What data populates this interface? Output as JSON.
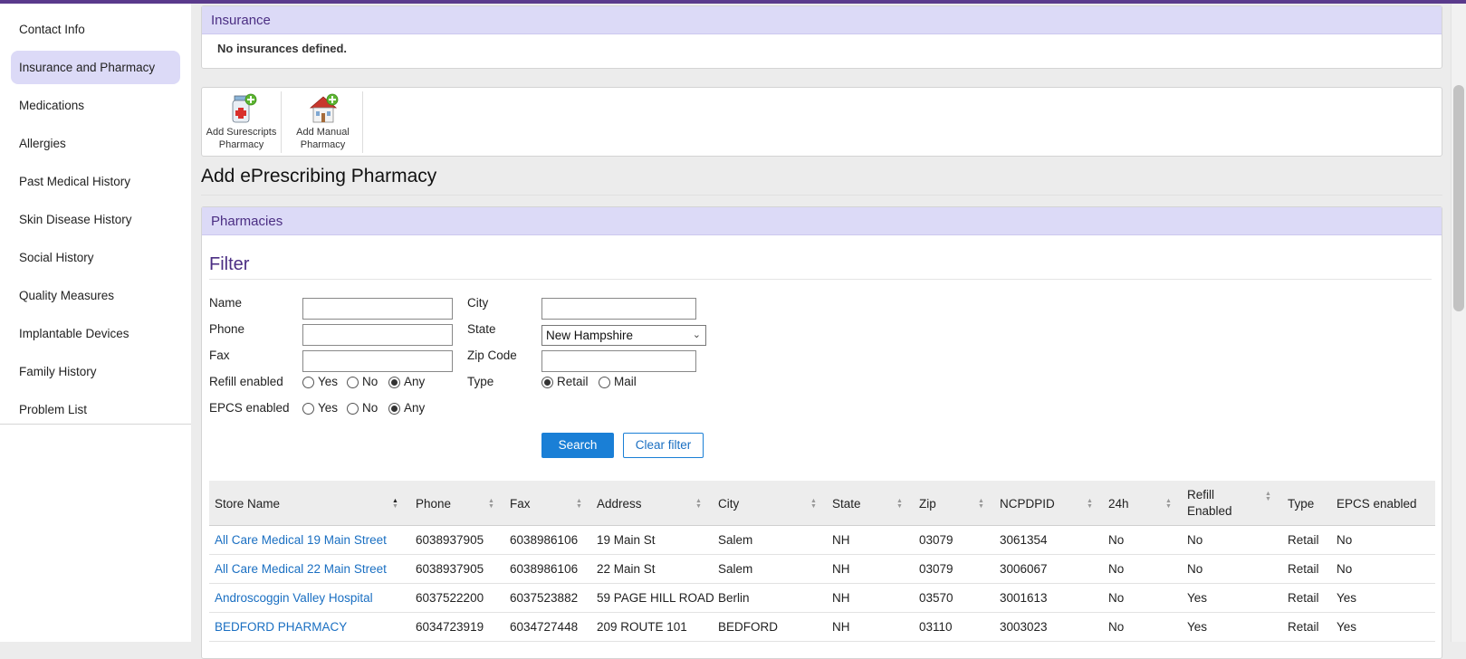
{
  "sidebar": {
    "items": [
      {
        "label": "Contact Info",
        "active": false
      },
      {
        "label": "Insurance and Pharmacy",
        "active": true
      },
      {
        "label": "Medications",
        "active": false
      },
      {
        "label": "Allergies",
        "active": false
      },
      {
        "label": "Past Medical History",
        "active": false
      },
      {
        "label": "Skin Disease History",
        "active": false
      },
      {
        "label": "Social History",
        "active": false
      },
      {
        "label": "Quality Measures",
        "active": false
      },
      {
        "label": "Implantable Devices",
        "active": false
      },
      {
        "label": "Family History",
        "active": false
      },
      {
        "label": "Problem List",
        "active": false
      }
    ]
  },
  "insurance": {
    "title": "Insurance",
    "message": "No insurances defined."
  },
  "toolbar": {
    "add_surescripts_line1": "Add Surescripts",
    "add_surescripts_line2": "Pharmacy",
    "add_manual_line1": "Add Manual",
    "add_manual_line2": "Pharmacy"
  },
  "page_title": "Add ePrescribing Pharmacy",
  "pharmacies": {
    "title": "Pharmacies",
    "filter": {
      "title": "Filter",
      "name_label": "Name",
      "name_value": "",
      "phone_label": "Phone",
      "phone_value": "",
      "fax_label": "Fax",
      "fax_value": "",
      "city_label": "City",
      "city_value": "",
      "state_label": "State",
      "state_value": "New Hampshire",
      "zip_label": "Zip Code",
      "zip_value": "",
      "refill_label": "Refill enabled",
      "epcs_label": "EPCS enabled",
      "type_label": "Type",
      "opt_yes": "Yes",
      "opt_no": "No",
      "opt_any": "Any",
      "opt_retail": "Retail",
      "opt_mail": "Mail",
      "refill_selected": "Any",
      "epcs_selected": "Any",
      "type_selected": "Retail",
      "search_label": "Search",
      "clear_label": "Clear filter"
    },
    "table": {
      "columns": {
        "store_name": "Store Name",
        "phone": "Phone",
        "fax": "Fax",
        "address": "Address",
        "city": "City",
        "state": "State",
        "zip": "Zip",
        "ncpdpid": "NCPDPID",
        "h24": "24h",
        "refill_line1": "Refill",
        "refill_line2": "Enabled",
        "type": "Type",
        "epcs": "EPCS enabled"
      },
      "rows": [
        {
          "store_name": "All Care Medical 19 Main Street",
          "phone": "6038937905",
          "fax": "6038986106",
          "address": "19 Main St",
          "city": "Salem",
          "state": "NH",
          "zip": "03079",
          "ncpdpid": "3061354",
          "h24": "No",
          "refill": "No",
          "type": "Retail",
          "epcs": "No"
        },
        {
          "store_name": "All Care Medical 22 Main Street",
          "phone": "6038937905",
          "fax": "6038986106",
          "address": "22 Main St",
          "city": "Salem",
          "state": "NH",
          "zip": "03079",
          "ncpdpid": "3006067",
          "h24": "No",
          "refill": "No",
          "type": "Retail",
          "epcs": "No"
        },
        {
          "store_name": "Androscoggin Valley Hospital",
          "phone": "6037522200",
          "fax": "6037523882",
          "address": "59 PAGE HILL ROAD",
          "city": "Berlin",
          "state": "NH",
          "zip": "03570",
          "ncpdpid": "3001613",
          "h24": "No",
          "refill": "Yes",
          "type": "Retail",
          "epcs": "Yes"
        },
        {
          "store_name": "BEDFORD PHARMACY",
          "phone": "6034723919",
          "fax": "6034727448",
          "address": "209 ROUTE 101",
          "city": "BEDFORD",
          "state": "NH",
          "zip": "03110",
          "ncpdpid": "3003023",
          "h24": "No",
          "refill": "Yes",
          "type": "Retail",
          "epcs": "Yes"
        }
      ]
    }
  },
  "colors": {
    "accent": "#4b2e83",
    "panel_header_bg": "#dcdaf7",
    "primary_button": "#1a7fd6",
    "link": "#1a6fc2"
  }
}
